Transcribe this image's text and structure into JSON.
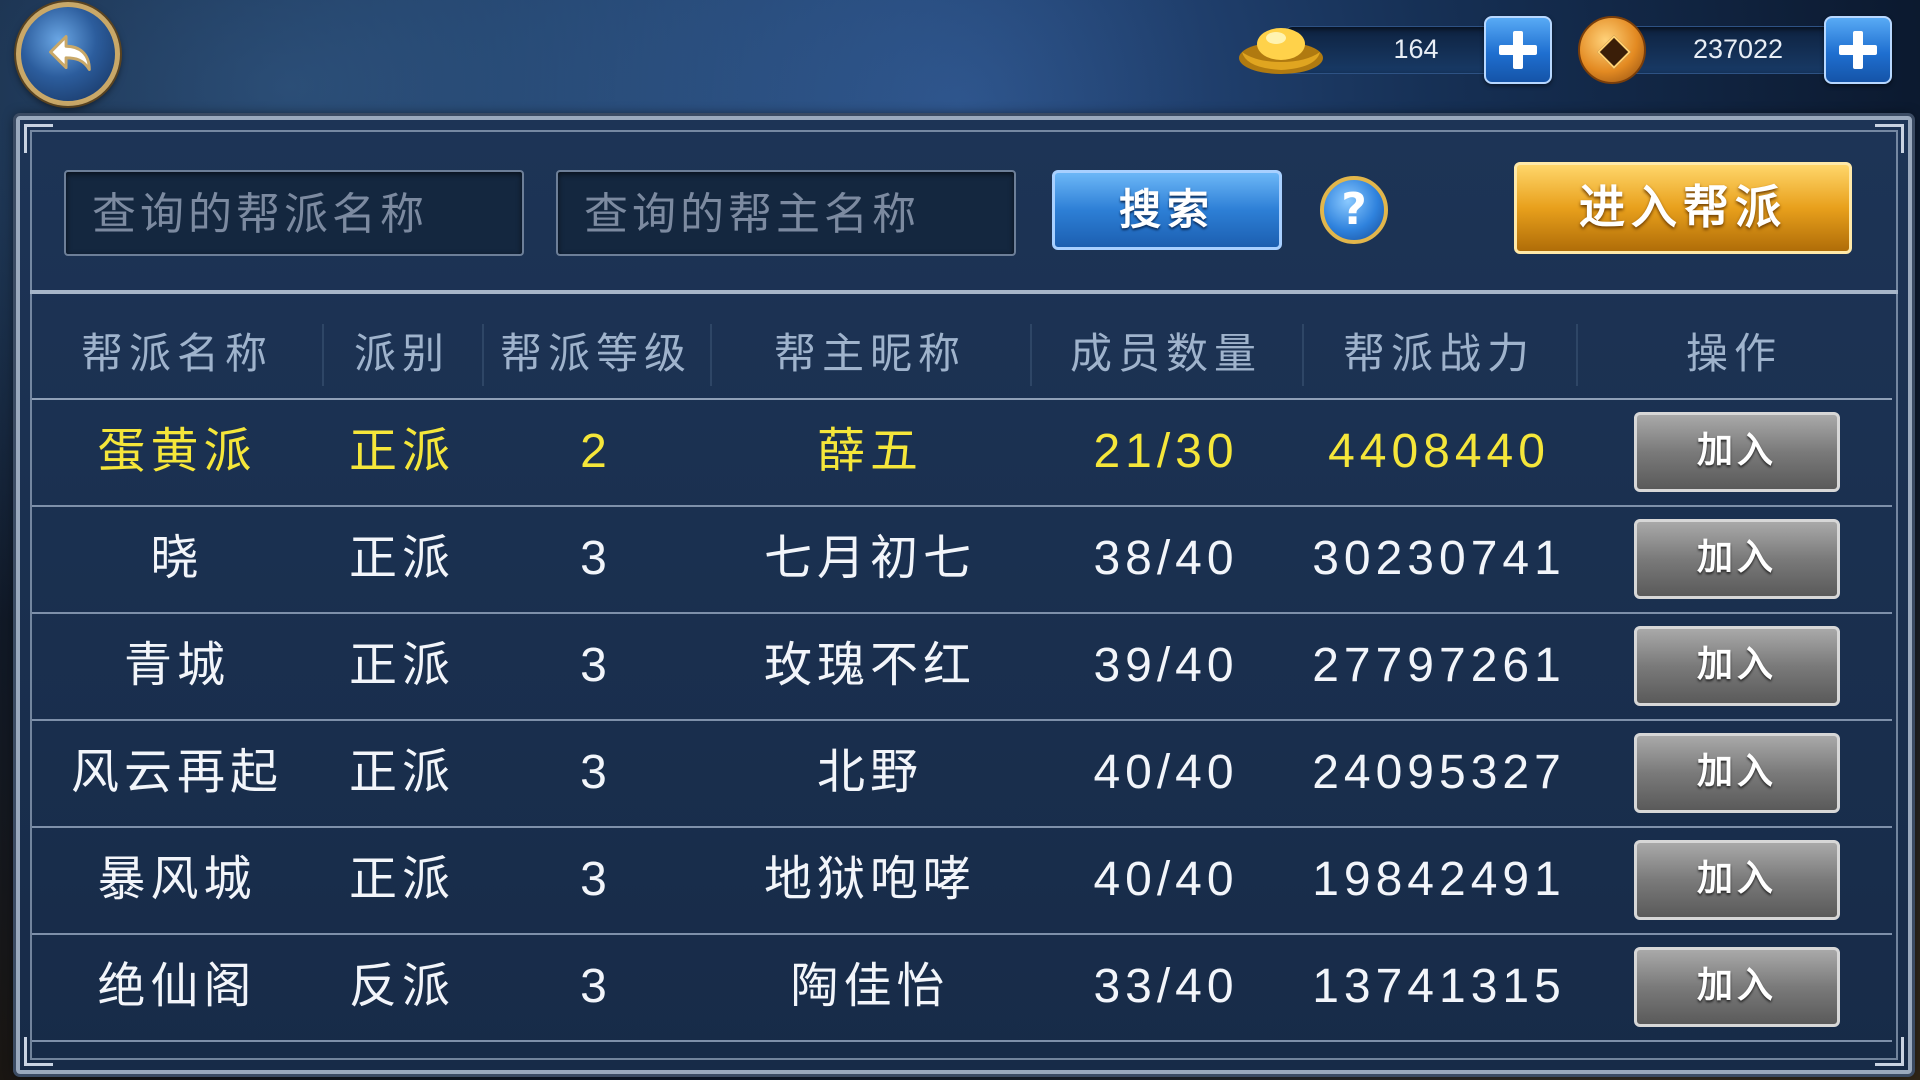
{
  "topbar": {
    "back_icon": "back-arrow-icon",
    "gold": {
      "icon": "gold-ingot-icon",
      "value": "164"
    },
    "coin": {
      "icon": "copper-coin-icon",
      "value": "237022"
    }
  },
  "search": {
    "guild_placeholder": "查询的帮派名称",
    "leader_placeholder": "查询的帮主名称",
    "search_label": "搜索",
    "help_label": "?",
    "enter_label": "进入帮派"
  },
  "table": {
    "headers": [
      "帮派名称",
      "派别",
      "帮派等级",
      "帮主昵称",
      "成员数量",
      "帮派战力",
      "操作"
    ],
    "rows": [
      {
        "name": "蛋黄派",
        "faction": "正派",
        "level": "2",
        "leader": "薛五",
        "members": "21/30",
        "power": "4408440",
        "action": "加入",
        "highlight": true
      },
      {
        "name": "晓",
        "faction": "正派",
        "level": "3",
        "leader": "七月初七",
        "members": "38/40",
        "power": "30230741",
        "action": "加入",
        "highlight": false
      },
      {
        "name": "青城",
        "faction": "正派",
        "level": "3",
        "leader": "玫瑰不红",
        "members": "39/40",
        "power": "27797261",
        "action": "加入",
        "highlight": false
      },
      {
        "name": "风云再起",
        "faction": "正派",
        "level": "3",
        "leader": "北野",
        "members": "40/40",
        "power": "24095327",
        "action": "加入",
        "highlight": false
      },
      {
        "name": "暴风城",
        "faction": "正派",
        "level": "3",
        "leader": "地狱咆哮",
        "members": "40/40",
        "power": "19842491",
        "action": "加入",
        "highlight": false
      },
      {
        "name": "绝仙阁",
        "faction": "反派",
        "level": "3",
        "leader": "陶佳怡",
        "members": "33/40",
        "power": "13741315",
        "action": "加入",
        "highlight": false
      }
    ]
  },
  "colors": {
    "highlight_text": "#f5e63a",
    "normal_text": "#f2f5fa",
    "header_text": "#9fb3cc",
    "enter_button": "#e8a01c",
    "search_button": "#2d7fd6"
  }
}
